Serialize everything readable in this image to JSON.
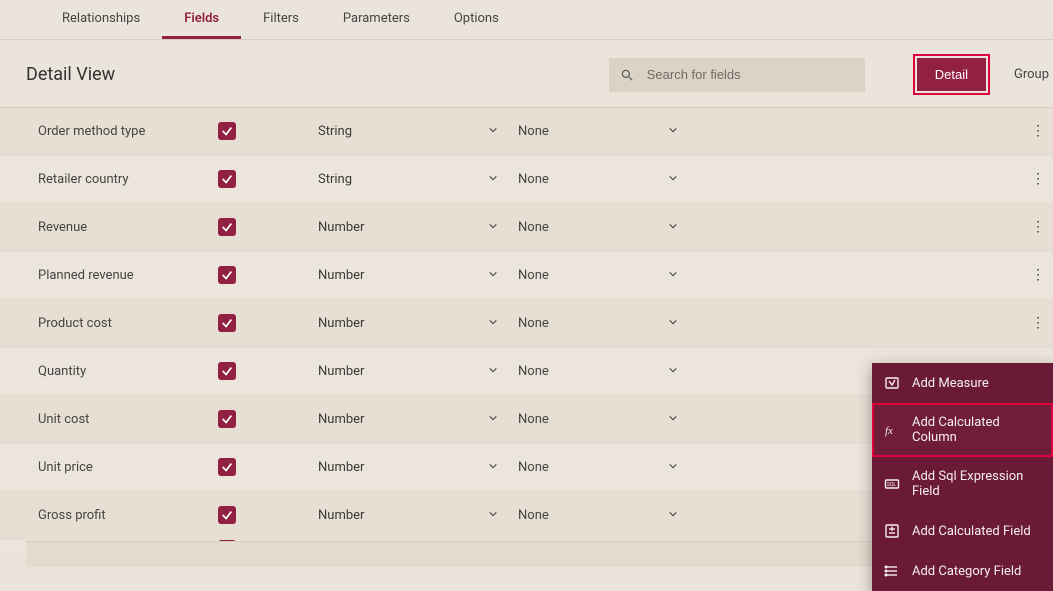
{
  "tabs": {
    "items": [
      "Relationships",
      "Fields",
      "Filters",
      "Parameters",
      "Options"
    ],
    "activeIndex": 1
  },
  "header": {
    "title": "Detail View",
    "search_placeholder": "Search for fields",
    "detail_button": "Detail",
    "group_label": "Group"
  },
  "fields": [
    {
      "name": "Order method type",
      "checked": true,
      "dtype": "String",
      "second": "None"
    },
    {
      "name": "Retailer country",
      "checked": true,
      "dtype": "String",
      "second": "None"
    },
    {
      "name": "Revenue",
      "checked": true,
      "dtype": "Number",
      "second": "None"
    },
    {
      "name": "Planned revenue",
      "checked": true,
      "dtype": "Number",
      "second": "None"
    },
    {
      "name": "Product cost",
      "checked": true,
      "dtype": "Number",
      "second": "None"
    },
    {
      "name": "Quantity",
      "checked": true,
      "dtype": "Number",
      "second": "None",
      "kebabHighlighted": true
    },
    {
      "name": "Unit cost",
      "checked": true,
      "dtype": "Number",
      "second": "None"
    },
    {
      "name": "Unit price",
      "checked": true,
      "dtype": "Number",
      "second": "None"
    },
    {
      "name": "Gross profit",
      "checked": true,
      "dtype": "Number",
      "second": "None"
    }
  ],
  "context_menu": {
    "items": [
      {
        "label": "Add Measure",
        "icon": "measure"
      },
      {
        "label": "Add Calculated Column",
        "icon": "fx",
        "highlighted": true
      },
      {
        "label": "Add Sql Expression Field",
        "icon": "sql"
      },
      {
        "label": "Add Calculated Field",
        "icon": "calcfield"
      },
      {
        "label": "Add Category Field",
        "icon": "category"
      }
    ]
  }
}
